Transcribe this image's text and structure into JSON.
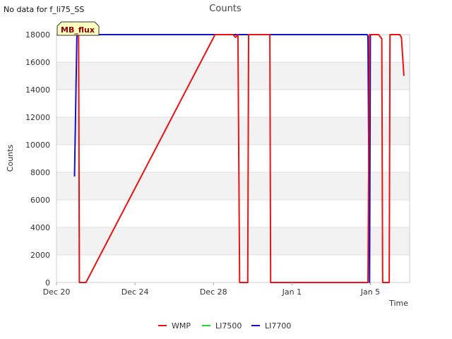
{
  "header": {
    "no_data_text": "No data for f_li75_SS"
  },
  "badge": {
    "text": "MB_flux",
    "fill": "#ffffc0",
    "stroke": "#333333",
    "text_color": "#8b0000"
  },
  "chart_data": {
    "type": "line",
    "title": "Counts",
    "xlabel": "Time",
    "ylabel": "Counts",
    "ylim": [
      0,
      18000
    ],
    "xlim": [
      "2023-12-20",
      "2024-01-07"
    ],
    "yticks": [
      0,
      2000,
      4000,
      6000,
      8000,
      10000,
      12000,
      14000,
      16000,
      18000
    ],
    "xticks": [
      {
        "label": "Dec 20",
        "date": "2023-12-20"
      },
      {
        "label": "Dec 24",
        "date": "2023-12-24"
      },
      {
        "label": "Dec 28",
        "date": "2023-12-28"
      },
      {
        "label": "Jan 1",
        "date": "2024-01-01"
      },
      {
        "label": "Jan 5",
        "date": "2024-01-05"
      }
    ],
    "grid": "horizontal alternating bands",
    "legend_position": "bottom",
    "series": [
      {
        "name": "WMP",
        "color": "#ee1111",
        "points": [
          [
            "2023-12-21 00:00",
            18000
          ],
          [
            "2023-12-21 03:00",
            18000
          ],
          [
            "2023-12-21 04:00",
            0
          ],
          [
            "2023-12-21 12:00",
            0
          ],
          [
            "2023-12-28 02:00",
            18000
          ],
          [
            "2023-12-29 00:00",
            18000
          ],
          [
            "2023-12-29 03:00",
            17800
          ],
          [
            "2023-12-29 06:00",
            18000
          ],
          [
            "2023-12-29 08:00",
            0
          ],
          [
            "2023-12-29 18:00",
            0
          ],
          [
            "2023-12-29 19:00",
            18000
          ],
          [
            "2023-12-30 21:00",
            18000
          ],
          [
            "2023-12-30 22:00",
            0
          ],
          [
            "2024-01-04 21:00",
            0
          ],
          [
            "2024-01-04 23:00",
            18000
          ],
          [
            "2024-01-05 10:00",
            18000
          ],
          [
            "2024-01-05 14:00",
            17700
          ],
          [
            "2024-01-05 15:00",
            0
          ],
          [
            "2024-01-05 23:00",
            0
          ],
          [
            "2024-01-06 00:00",
            18000
          ],
          [
            "2024-01-06 12:00",
            18000
          ],
          [
            "2024-01-06 14:00",
            17800
          ],
          [
            "2024-01-06 17:00",
            15000
          ]
        ]
      },
      {
        "name": "LI7500",
        "color": "#22dd22",
        "points": []
      },
      {
        "name": "LI7700",
        "color": "#1111cc",
        "points": [
          [
            "2023-12-20 22:00",
            7700
          ],
          [
            "2023-12-21 01:00",
            18000
          ],
          [
            "2023-12-21 03:00",
            18000
          ],
          [
            "2023-12-21 04:00",
            18000
          ],
          [
            "2024-01-04 20:00",
            18000
          ],
          [
            "2024-01-04 21:00",
            17900
          ],
          [
            "2024-01-04 23:00",
            0
          ],
          [
            "2024-01-05 00:00",
            18000
          ],
          [
            "2024-01-05 08:00",
            18000
          ]
        ]
      }
    ]
  }
}
